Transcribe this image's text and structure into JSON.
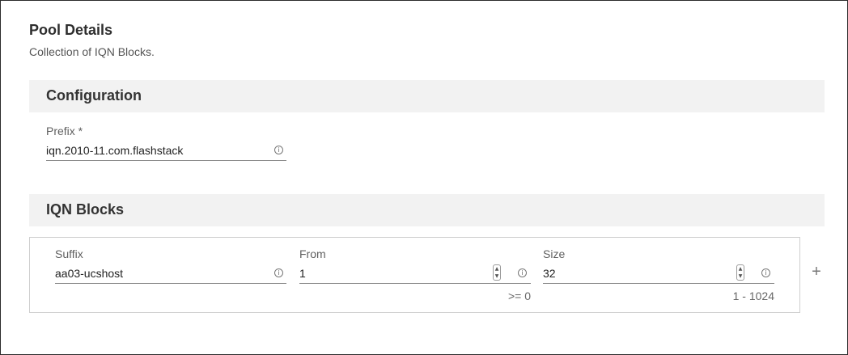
{
  "header": {
    "title": "Pool Details",
    "subtitle": "Collection of IQN Blocks."
  },
  "configuration": {
    "section_label": "Configuration",
    "prefix_label": "Prefix *",
    "prefix_value": "iqn.2010-11.com.flashstack"
  },
  "iqn_blocks": {
    "section_label": "IQN Blocks",
    "suffix_label": "Suffix",
    "suffix_value": "aa03-ucshost",
    "from_label": "From",
    "from_value": "1",
    "from_hint": ">= 0",
    "size_label": "Size",
    "size_value": "32",
    "size_hint": "1 - 1024",
    "add_label": "+"
  },
  "icons": {
    "info": "info-icon",
    "stepper_up": "chevron-up-icon",
    "stepper_down": "chevron-down-icon",
    "add": "plus-icon"
  }
}
